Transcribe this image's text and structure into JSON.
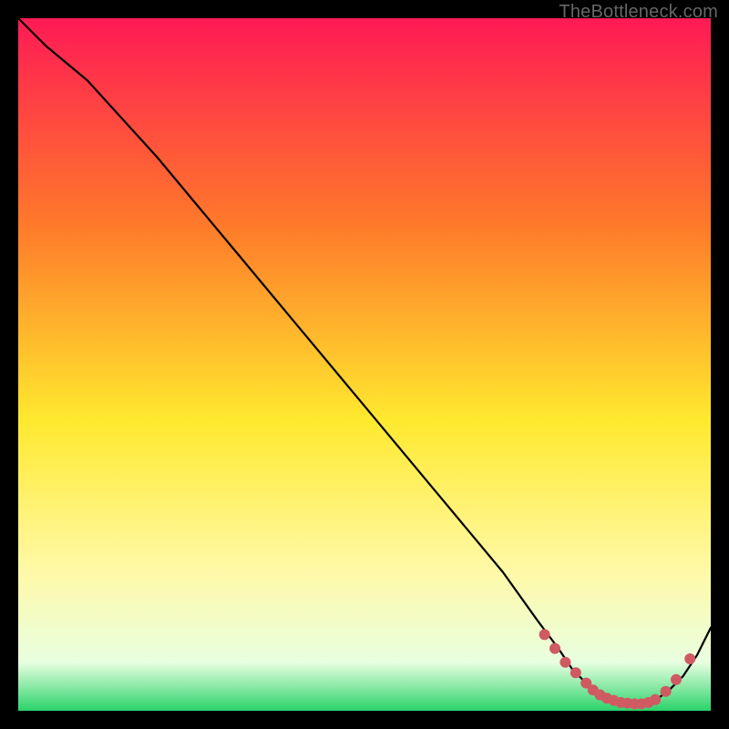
{
  "watermark": "TheBottleneck.com",
  "colors": {
    "gradient_top": "#ff1a55",
    "gradient_upper_mid": "#ff8a2a",
    "gradient_mid": "#ffe92e",
    "gradient_lower_mid": "#fff9a8",
    "gradient_bottom": "#2bd36b",
    "line": "#000000",
    "marker": "#cf5a62"
  },
  "chart_data": {
    "type": "line",
    "title": "",
    "xlabel": "",
    "ylabel": "",
    "xlim": [
      0,
      100
    ],
    "ylim": [
      0,
      100
    ],
    "legend": false,
    "grid": false,
    "series": [
      {
        "name": "curve",
        "x": [
          0,
          4,
          10,
          20,
          30,
          40,
          50,
          60,
          70,
          75,
          78,
          80,
          82,
          84,
          86,
          88,
          90,
          92,
          94,
          96,
          98,
          100
        ],
        "y": [
          100,
          96,
          91,
          80,
          68,
          56,
          44,
          32,
          20,
          13,
          9,
          6,
          4,
          2.5,
          1.5,
          1,
          1,
          1.5,
          3,
          5,
          8,
          12
        ]
      }
    ],
    "markers": {
      "name": "highlight-dots",
      "x": [
        76,
        77.5,
        79,
        80.5,
        82,
        83,
        84,
        85,
        86,
        87,
        88,
        89,
        90,
        91,
        92,
        93.5,
        95,
        97
      ],
      "y": [
        11,
        9,
        7,
        5.5,
        4,
        3,
        2.3,
        1.8,
        1.5,
        1.2,
        1.1,
        1.0,
        1.0,
        1.2,
        1.6,
        2.8,
        4.5,
        7.5
      ]
    }
  }
}
